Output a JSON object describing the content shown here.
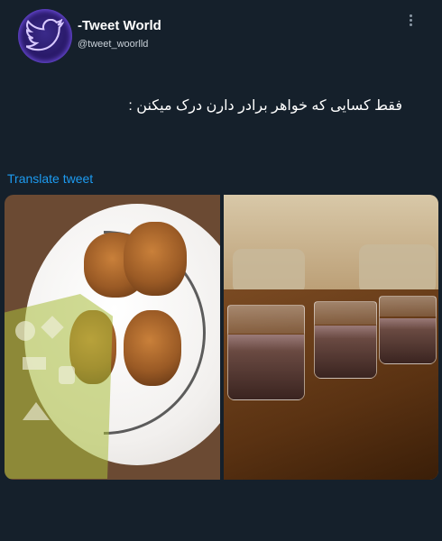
{
  "tweet": {
    "display_name": "-Tweet World",
    "handle": "@tweet_woorlld",
    "text": "فقط کسایی که خواهر برادر دارن درک میکنن :",
    "translate_label": "Translate tweet"
  },
  "icons": {
    "avatar": "bird-icon",
    "more": "more-icon"
  },
  "colors": {
    "background": "#15202b",
    "link": "#1d9bf0",
    "avatar_glow": "#6a4bd8"
  }
}
